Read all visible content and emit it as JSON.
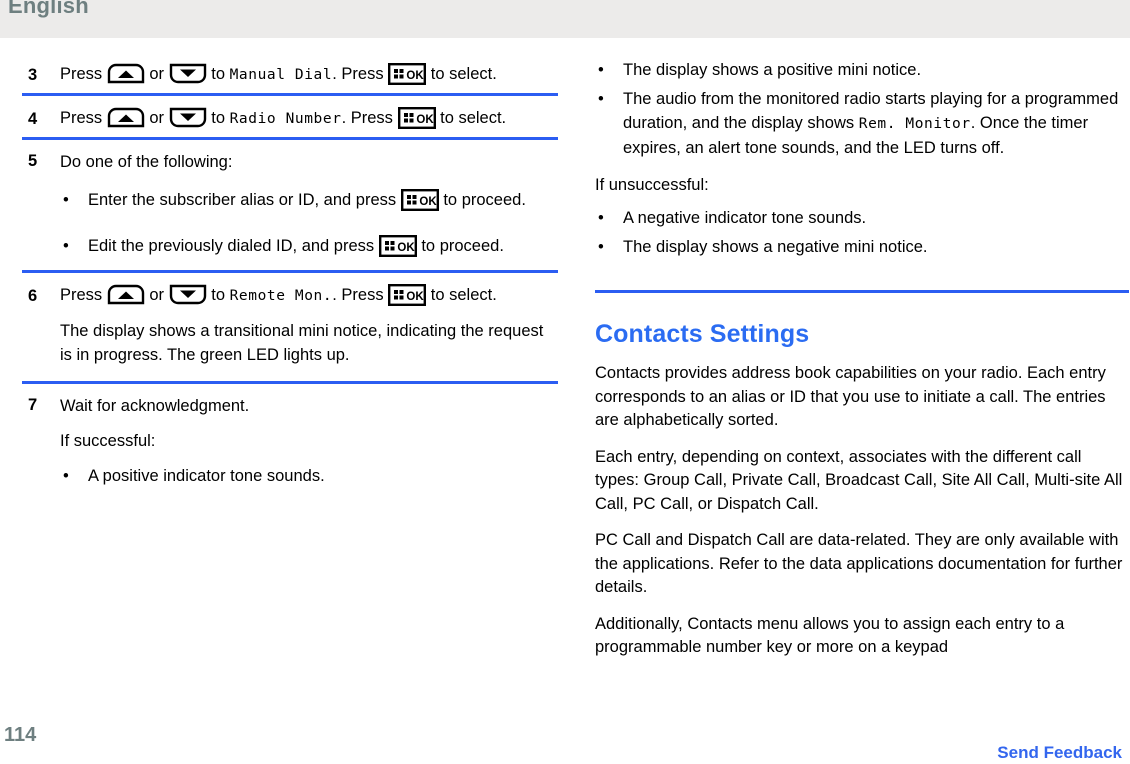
{
  "header": {
    "language": "English"
  },
  "footer": {
    "page_number": "114",
    "send_feedback": "Send Feedback",
    "link_color": "#3366EE",
    "page_number_color": "#6E7F80"
  },
  "theme": {
    "divider_blue": "#2B5DF2",
    "heading_blue": "#2B6CF2",
    "header_band": "#ECEBEA"
  },
  "icons": {
    "up_arrow_key": "up-arrow-key-icon",
    "down_arrow_key": "down-arrow-key-icon",
    "ok_key": "ok-menu-key-icon",
    "ok_label": "OK"
  },
  "left_column": {
    "steps": [
      {
        "number": "3",
        "text_before_up": "Press",
        "text_or": "or",
        "text_to": "to",
        "display_value": "Manual Dial",
        "text_after_display": ". Press",
        "text_tail": "to select."
      },
      {
        "number": "4",
        "text_before_up": "Press",
        "text_or": "or",
        "text_to": "to",
        "display_value": "Radio Number",
        "text_after_display": ". Press",
        "text_tail": "to select."
      },
      {
        "number": "5",
        "lead": "Do one of the following:",
        "bullets": [
          {
            "part1": "Enter the subscriber alias or ID, and press",
            "part2": "to proceed."
          },
          {
            "part1": "Edit the previously dialed ID, and press",
            "part2": "to proceed."
          }
        ]
      },
      {
        "number": "6",
        "text_before_up": "Press",
        "text_or": "or",
        "text_to": "to",
        "display_value": "Remote Mon.",
        "text_after_display": ". Press",
        "text_tail": "to select.",
        "note": "The display shows a transitional mini notice, indicating the request is in progress. The green LED lights up."
      },
      {
        "number": "7",
        "lead": "Wait for acknowledgment.",
        "sublead": "If successful:",
        "bullets": [
          "A positive indicator tone sounds."
        ]
      }
    ]
  },
  "right_column": {
    "success_bullets": [
      "The display shows a positive mini notice.",
      "The audio from the monitored radio starts playing for a programmed duration, and the display shows Rem. Monitor. Once the timer expires, an alert tone sounds, and the LED turns off."
    ],
    "audio_bullet_parts": {
      "part1": "The audio from the monitored radio starts playing for a programmed duration, and the display shows",
      "display_value": "Rem. Monitor",
      "part2": ". Once the timer expires, an alert tone sounds, and the LED turns off."
    },
    "unsuccessful_label": "If unsuccessful:",
    "failure_bullets": [
      "A negative indicator tone sounds.",
      "The display shows a negative mini notice."
    ],
    "section": {
      "title": "Contacts Settings",
      "paragraphs": [
        "Contacts provides address book capabilities on your radio. Each entry corresponds to an alias or ID that you use to initiate a call. The entries are alphabetically sorted.",
        "Each entry, depending on context, associates with the different call types: Group Call, Private Call, Broadcast Call, Site All Call, Multi-site All Call, PC Call, or Dispatch Call.",
        "PC Call and Dispatch Call are data-related. They are only available with the applications. Refer to the data applications documentation for further details.",
        "Additionally, Contacts menu allows you to assign each entry to a programmable number key or more on a keypad"
      ]
    }
  }
}
